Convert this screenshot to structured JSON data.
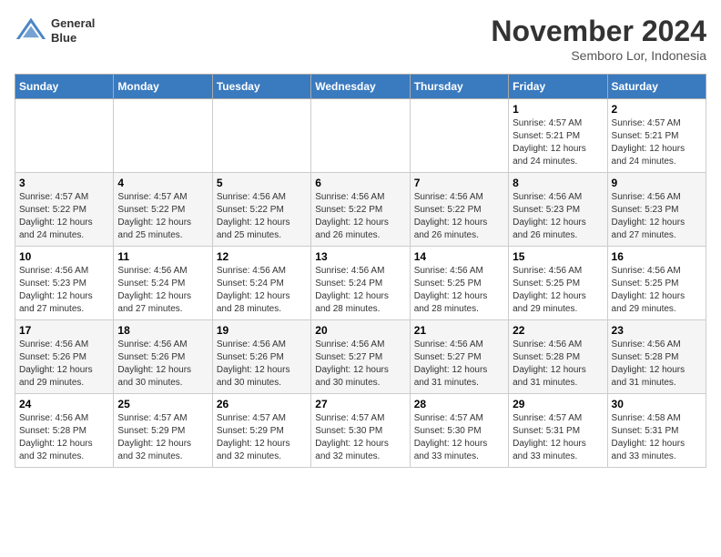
{
  "header": {
    "logo_line1": "General",
    "logo_line2": "Blue",
    "month": "November 2024",
    "location": "Semboro Lor, Indonesia"
  },
  "weekdays": [
    "Sunday",
    "Monday",
    "Tuesday",
    "Wednesday",
    "Thursday",
    "Friday",
    "Saturday"
  ],
  "weeks": [
    [
      {
        "day": "",
        "info": ""
      },
      {
        "day": "",
        "info": ""
      },
      {
        "day": "",
        "info": ""
      },
      {
        "day": "",
        "info": ""
      },
      {
        "day": "",
        "info": ""
      },
      {
        "day": "1",
        "info": "Sunrise: 4:57 AM\nSunset: 5:21 PM\nDaylight: 12 hours and 24 minutes."
      },
      {
        "day": "2",
        "info": "Sunrise: 4:57 AM\nSunset: 5:21 PM\nDaylight: 12 hours and 24 minutes."
      }
    ],
    [
      {
        "day": "3",
        "info": "Sunrise: 4:57 AM\nSunset: 5:22 PM\nDaylight: 12 hours and 24 minutes."
      },
      {
        "day": "4",
        "info": "Sunrise: 4:57 AM\nSunset: 5:22 PM\nDaylight: 12 hours and 25 minutes."
      },
      {
        "day": "5",
        "info": "Sunrise: 4:56 AM\nSunset: 5:22 PM\nDaylight: 12 hours and 25 minutes."
      },
      {
        "day": "6",
        "info": "Sunrise: 4:56 AM\nSunset: 5:22 PM\nDaylight: 12 hours and 26 minutes."
      },
      {
        "day": "7",
        "info": "Sunrise: 4:56 AM\nSunset: 5:22 PM\nDaylight: 12 hours and 26 minutes."
      },
      {
        "day": "8",
        "info": "Sunrise: 4:56 AM\nSunset: 5:23 PM\nDaylight: 12 hours and 26 minutes."
      },
      {
        "day": "9",
        "info": "Sunrise: 4:56 AM\nSunset: 5:23 PM\nDaylight: 12 hours and 27 minutes."
      }
    ],
    [
      {
        "day": "10",
        "info": "Sunrise: 4:56 AM\nSunset: 5:23 PM\nDaylight: 12 hours and 27 minutes."
      },
      {
        "day": "11",
        "info": "Sunrise: 4:56 AM\nSunset: 5:24 PM\nDaylight: 12 hours and 27 minutes."
      },
      {
        "day": "12",
        "info": "Sunrise: 4:56 AM\nSunset: 5:24 PM\nDaylight: 12 hours and 28 minutes."
      },
      {
        "day": "13",
        "info": "Sunrise: 4:56 AM\nSunset: 5:24 PM\nDaylight: 12 hours and 28 minutes."
      },
      {
        "day": "14",
        "info": "Sunrise: 4:56 AM\nSunset: 5:25 PM\nDaylight: 12 hours and 28 minutes."
      },
      {
        "day": "15",
        "info": "Sunrise: 4:56 AM\nSunset: 5:25 PM\nDaylight: 12 hours and 29 minutes."
      },
      {
        "day": "16",
        "info": "Sunrise: 4:56 AM\nSunset: 5:25 PM\nDaylight: 12 hours and 29 minutes."
      }
    ],
    [
      {
        "day": "17",
        "info": "Sunrise: 4:56 AM\nSunset: 5:26 PM\nDaylight: 12 hours and 29 minutes."
      },
      {
        "day": "18",
        "info": "Sunrise: 4:56 AM\nSunset: 5:26 PM\nDaylight: 12 hours and 30 minutes."
      },
      {
        "day": "19",
        "info": "Sunrise: 4:56 AM\nSunset: 5:26 PM\nDaylight: 12 hours and 30 minutes."
      },
      {
        "day": "20",
        "info": "Sunrise: 4:56 AM\nSunset: 5:27 PM\nDaylight: 12 hours and 30 minutes."
      },
      {
        "day": "21",
        "info": "Sunrise: 4:56 AM\nSunset: 5:27 PM\nDaylight: 12 hours and 31 minutes."
      },
      {
        "day": "22",
        "info": "Sunrise: 4:56 AM\nSunset: 5:28 PM\nDaylight: 12 hours and 31 minutes."
      },
      {
        "day": "23",
        "info": "Sunrise: 4:56 AM\nSunset: 5:28 PM\nDaylight: 12 hours and 31 minutes."
      }
    ],
    [
      {
        "day": "24",
        "info": "Sunrise: 4:56 AM\nSunset: 5:28 PM\nDaylight: 12 hours and 32 minutes."
      },
      {
        "day": "25",
        "info": "Sunrise: 4:57 AM\nSunset: 5:29 PM\nDaylight: 12 hours and 32 minutes."
      },
      {
        "day": "26",
        "info": "Sunrise: 4:57 AM\nSunset: 5:29 PM\nDaylight: 12 hours and 32 minutes."
      },
      {
        "day": "27",
        "info": "Sunrise: 4:57 AM\nSunset: 5:30 PM\nDaylight: 12 hours and 32 minutes."
      },
      {
        "day": "28",
        "info": "Sunrise: 4:57 AM\nSunset: 5:30 PM\nDaylight: 12 hours and 33 minutes."
      },
      {
        "day": "29",
        "info": "Sunrise: 4:57 AM\nSunset: 5:31 PM\nDaylight: 12 hours and 33 minutes."
      },
      {
        "day": "30",
        "info": "Sunrise: 4:58 AM\nSunset: 5:31 PM\nDaylight: 12 hours and 33 minutes."
      }
    ]
  ]
}
